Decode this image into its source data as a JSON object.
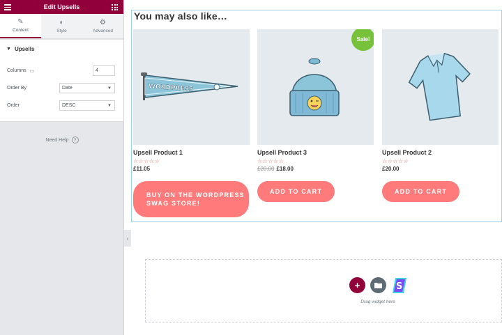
{
  "panel": {
    "title": "Edit Upsells",
    "tabs": [
      {
        "label": "Content",
        "icon": "pencil-icon"
      },
      {
        "label": "Style",
        "icon": "half-circle-icon"
      },
      {
        "label": "Advanced",
        "icon": "gear-icon"
      }
    ],
    "section_title": "Upsells",
    "controls": {
      "columns_label": "Columns",
      "columns_value": "4",
      "order_by_label": "Order By",
      "order_by_value": "Date",
      "order_label": "Order",
      "order_value": "DESC"
    },
    "help_label": "Need Help"
  },
  "canvas": {
    "heading": "You may also like…",
    "products": [
      {
        "title": "Upsell Product 1",
        "stars": "☆☆☆☆☆",
        "price": "£11.05",
        "old_price": "",
        "button": "BUY ON THE WORDPRESS SWAG STORE!"
      },
      {
        "title": "Upsell Product 3",
        "stars": "☆☆☆☆☆",
        "price": "£18.00",
        "old_price": "£20.00",
        "button": "ADD TO CART",
        "badge": "Sale!"
      },
      {
        "title": "Upsell Product 2",
        "stars": "☆☆☆☆☆",
        "price": "£20.00",
        "old_price": "",
        "button": "ADD TO CART"
      }
    ],
    "pennant_text": "WORDPRESS"
  },
  "dropzone": {
    "text": "Drag widget here"
  },
  "colors": {
    "brand": "#92003b",
    "button": "#ff7a7a",
    "sale": "#77c23a"
  }
}
